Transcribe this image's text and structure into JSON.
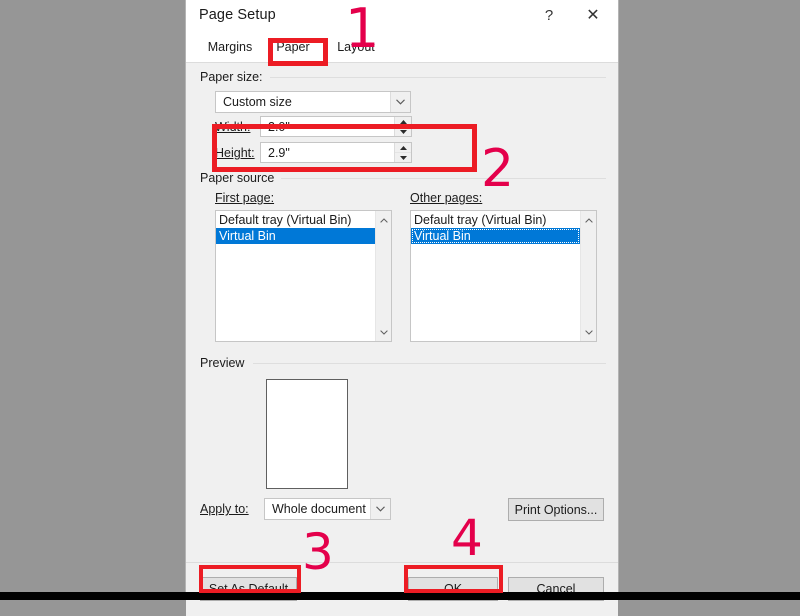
{
  "window": {
    "title": "Page Setup",
    "help_icon": "question-mark-icon",
    "help_glyph": "?",
    "close_icon": "close-icon",
    "close_glyph": "✕"
  },
  "tabs": [
    {
      "label": "Margins",
      "selected": false
    },
    {
      "label": "Paper",
      "selected": true
    },
    {
      "label": "Layout",
      "selected": false
    }
  ],
  "paper_size": {
    "group_label": "Paper size:",
    "size_combo": {
      "value": "Custom size",
      "arrow_icon": "chevron-down-icon",
      "arrow_glyph": "⌄"
    },
    "width": {
      "label": "Width:",
      "value": "2.0\"",
      "up_glyph": "▲",
      "down_glyph": "▼"
    },
    "height": {
      "label": "Height:",
      "value": "2.9\"",
      "up_glyph": "▲",
      "down_glyph": "▼"
    }
  },
  "paper_source": {
    "group_label": "Paper source",
    "first_page": {
      "label": "First page:",
      "items": [
        "Default tray (Virtual Bin)",
        "Virtual Bin"
      ],
      "selected_index": 1
    },
    "other_pages": {
      "label": "Other pages:",
      "items": [
        "Default tray (Virtual Bin)",
        "Virtual Bin"
      ],
      "selected_index": 1
    },
    "scroll_up_glyph": "∧",
    "scroll_down_glyph": "∨"
  },
  "preview": {
    "group_label": "Preview"
  },
  "apply_to": {
    "label": "Apply to:",
    "value": "Whole document",
    "arrow_icon": "chevron-down-icon",
    "arrow_glyph": "⌄"
  },
  "buttons": {
    "print_options": "Print Options...",
    "set_as_default": "Set As Default",
    "ok": "OK",
    "cancel": "Cancel"
  },
  "annotations": {
    "numbers": [
      "1",
      "2",
      "3",
      "4"
    ],
    "number_color": "#e4004b",
    "box_color": "#ec1c24"
  }
}
